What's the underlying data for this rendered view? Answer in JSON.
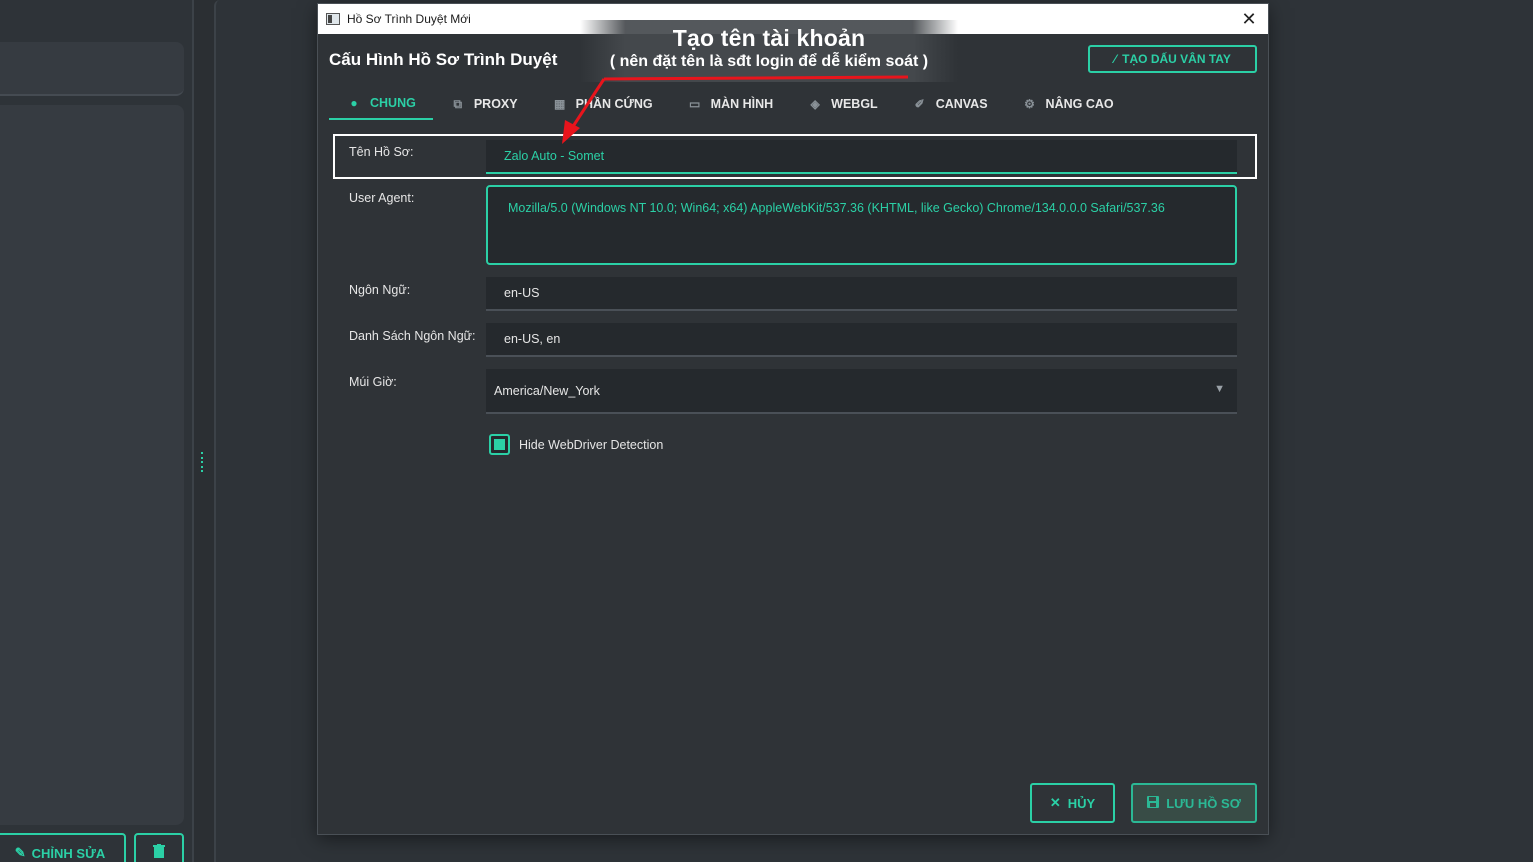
{
  "background": {
    "edit_button_label": "CHỈNH SỬA"
  },
  "window": {
    "title": "Hồ Sơ Trình Duyệt Mới"
  },
  "dialog": {
    "heading": "Cấu Hình Hồ Sơ Trình Duyệt",
    "fingerprint_button": "TẠO DẤU VÂN TAY",
    "tabs": [
      {
        "label": "CHUNG",
        "icon": "info-icon",
        "active": true
      },
      {
        "label": "PROXY",
        "icon": "network-icon",
        "active": false
      },
      {
        "label": "PHẦN CỨNG",
        "icon": "chip-icon",
        "active": false
      },
      {
        "label": "MÀN HÌNH",
        "icon": "monitor-icon",
        "active": false
      },
      {
        "label": "WEBGL",
        "icon": "cube-icon",
        "active": false
      },
      {
        "label": "CANVAS",
        "icon": "brush-icon",
        "active": false
      },
      {
        "label": "NÂNG CAO",
        "icon": "gear-icon",
        "active": false
      }
    ],
    "fields": {
      "profile_name": {
        "label": "Tên Hồ Sơ:",
        "value": "Zalo Auto - Somet"
      },
      "user_agent": {
        "label": "User Agent:",
        "value": "Mozilla/5.0 (Windows NT 10.0; Win64; x64) AppleWebKit/537.36 (KHTML, like Gecko) Chrome/134.0.0.0 Safari/537.36"
      },
      "language": {
        "label": "Ngôn Ngữ:",
        "value": "en-US"
      },
      "language_list": {
        "label": "Danh Sách Ngôn Ngữ:",
        "value": "en-US, en"
      },
      "timezone": {
        "label": "Múi Giờ:",
        "value": "America/New_York"
      }
    },
    "hide_webdriver": {
      "label": "Hide WebDriver Detection",
      "checked": true
    },
    "cancel_button": "HỦY",
    "save_button": "LƯU HỒ SƠ"
  },
  "annotation": {
    "title": "Tạo tên tài khoản",
    "subtitle": "( nên đặt tên là sđt login để dễ kiểm soát )"
  },
  "colors": {
    "accent": "#2bd0a6",
    "annotation_arrow": "#e8141c"
  }
}
